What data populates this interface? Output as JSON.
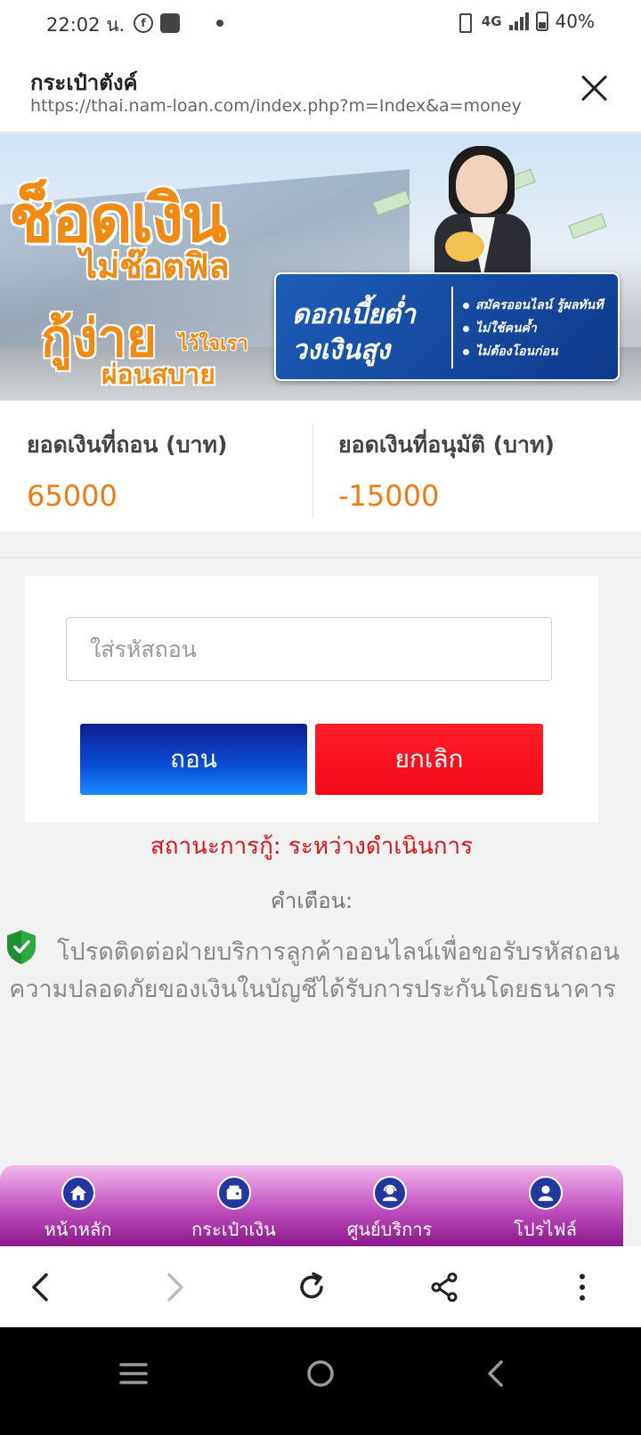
{
  "status_bar": {
    "time": "22:02 น.",
    "network": "4G",
    "battery": "40%"
  },
  "browser": {
    "title": "กระเป๋าตังค์",
    "url": "https://thai.nam-loan.com/index.php?m=Index&a=money"
  },
  "banner": {
    "line1": "ช็อดเงิน",
    "line2": "ไม่ช๊อตฟิล",
    "line3": "กู้ง่าย",
    "line4": "ไว้ใจเรา",
    "line5": "ผ่อนสบาย",
    "panel_line1": "ดอกเบี้ยต่ำ",
    "panel_line2": "วงเงินสูง",
    "features": [
      "สมัครออนไลน์ รู้ผลทันที",
      "ไม่ใช้คนค้ำ",
      "ไม่ต้องโอนก่อน"
    ]
  },
  "balance": {
    "withdraw_label": "ยอดเงินที่ถอน (บาท)",
    "withdraw_value": "65000",
    "approved_label": "ยอดเงินที่อนุมัติ (บาท)",
    "approved_value": "-15000"
  },
  "form": {
    "code_placeholder": "ใส่รหัสถอน",
    "withdraw_button": "ถอน",
    "cancel_button": "ยกเลิก"
  },
  "status": {
    "loan_status": "สถานะการกู้: ระหว่างดำเนินการ",
    "warning_title": "คำเตือน:",
    "warning_text": "โปรดติดต่อฝ่ายบริการลูกค้าออนไลน์เพื่อขอรับรหัสถอนความปลอดภัยของเงินในบัญชีได้รับการประกันโดยธนาคาร"
  },
  "bottom_nav": [
    {
      "label": "หน้าหลัก",
      "icon": "home-icon"
    },
    {
      "label": "กระเป๋าเงิน",
      "icon": "wallet-icon"
    },
    {
      "label": "ศูนย์บริการ",
      "icon": "support-icon"
    },
    {
      "label": "โปรไฟล์",
      "icon": "profile-icon"
    }
  ],
  "colors": {
    "accent_orange": "#f27a12",
    "withdraw_blue": "#0a4fd6",
    "cancel_red": "#f10a17",
    "status_red": "#d71519",
    "nav_purple": "#c04fc0"
  }
}
